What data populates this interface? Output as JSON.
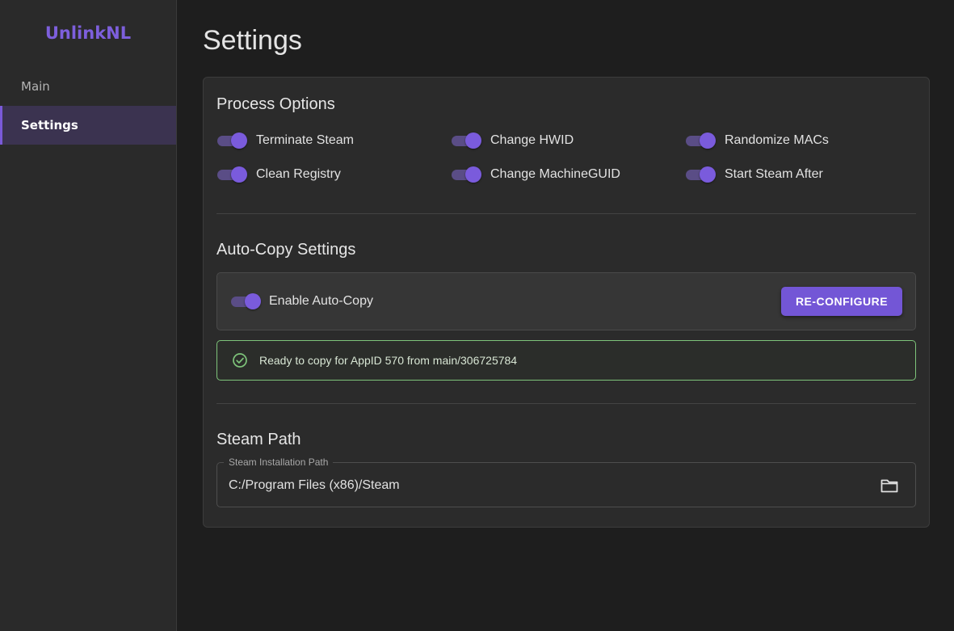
{
  "app": {
    "brand": "UnlinkNL",
    "accent_color": "#7356d6"
  },
  "sidebar": {
    "items": [
      {
        "label": "Main",
        "active": false
      },
      {
        "label": "Settings",
        "active": true
      }
    ]
  },
  "page": {
    "title": "Settings"
  },
  "process_options": {
    "title": "Process Options",
    "options": [
      {
        "label": "Terminate Steam",
        "enabled": true
      },
      {
        "label": "Change HWID",
        "enabled": true
      },
      {
        "label": "Randomize MACs",
        "enabled": true
      },
      {
        "label": "Clean Registry",
        "enabled": true
      },
      {
        "label": "Change MachineGUID",
        "enabled": true
      },
      {
        "label": "Start Steam After",
        "enabled": true
      }
    ]
  },
  "auto_copy": {
    "title": "Auto-Copy Settings",
    "toggle_label": "Enable Auto-Copy",
    "enabled": true,
    "reconfigure_label": "RE-CONFIGURE",
    "status_text": "Ready to copy for AppID 570 from main/306725784",
    "status_color": "#7ec47a"
  },
  "steam_path": {
    "title": "Steam Path",
    "field_label": "Steam Installation Path",
    "value": "C:/Program Files (x86)/Steam",
    "browse_icon": "folder-icon"
  }
}
